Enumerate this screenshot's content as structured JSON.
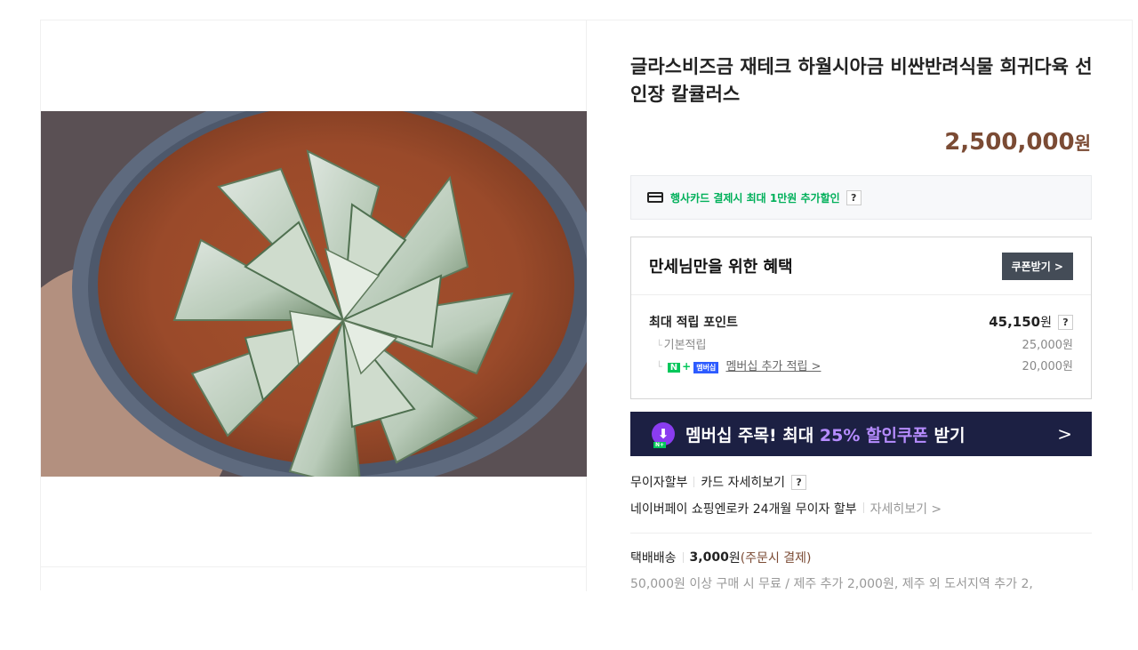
{
  "product": {
    "title": "글라스비즈금 재테크 하월시아금 비싼반려식물 희귀다육 선인장 칼큘러스",
    "price": "2,500,000",
    "price_unit": "원"
  },
  "card_promo": {
    "text": "행사카드 결제시 최대 1만원 추가할인",
    "help": "?"
  },
  "benefit": {
    "title": "만세님만을 위한 혜택",
    "coupon_button": "쿠폰받기 >",
    "max_points_label": "최대 적립 포인트",
    "max_points_value": "45,150",
    "max_points_unit": "원",
    "help": "?",
    "base_label": "기본적립",
    "base_value": "25,000원",
    "membership_badge_n": "N",
    "membership_badge_plus": "+",
    "membership_badge_text": "멤버십",
    "membership_label": "멤버십 추가 적립 >",
    "membership_value": "20,000원"
  },
  "banner": {
    "text_before": "멤버십 주목! 최대 ",
    "text_highlight": "25% 할인쿠폰",
    "text_after": " 받기",
    "arrow": ">"
  },
  "payment": {
    "installment_label": "무이자할부",
    "card_detail": "카드 자세히보기",
    "help": "?",
    "naverpay_text": "네이버페이 쇼핑엔로카 24개월 무이자 할부",
    "naverpay_more": "자세히보기 >"
  },
  "shipping": {
    "label": "택배배송",
    "fee": "3,000",
    "unit": "원",
    "note": "(주문시 결제)",
    "detail": "50,000원 이상 구매 시 무료 / 제주 추가 2,000원, 제주 외 도서지역 추가 2,"
  },
  "colors": {
    "price": "#7b4b34",
    "promo_green": "#00b05a",
    "banner_bg": "#1c2043",
    "banner_highlight": "#b68cff",
    "coupon_button_bg": "#444c57"
  }
}
